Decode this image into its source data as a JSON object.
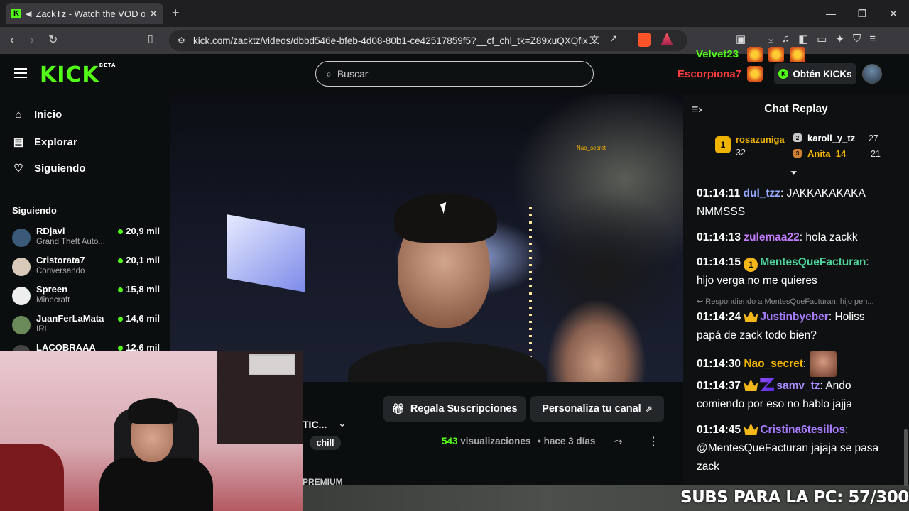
{
  "browser": {
    "tab_title": "ZackTz - Watch the VOD on K",
    "tab_close": "✕",
    "new_tab": "+",
    "url": "kick.com/zacktz/videos/dbbd546e-bfeb-4d08-80b1-ce42517859f5?__cf_chl_tk=Z89xuQXQflx...",
    "window_controls": [
      "—",
      "❐",
      "✕"
    ]
  },
  "header": {
    "logo": "KICK",
    "logo_badge": "BETA",
    "search_placeholder": "Buscar",
    "get_kicks": "Obtén KICKs"
  },
  "overlay": {
    "user1": "Velvet23",
    "user2": "Escorpiona7",
    "video_tag": "Nao_secret"
  },
  "sidebar": {
    "nav": [
      {
        "label": "Inicio",
        "icon": "home-icon"
      },
      {
        "label": "Explorar",
        "icon": "compass-icon"
      },
      {
        "label": "Siguiendo",
        "icon": "heart-icon"
      }
    ],
    "following_heading": "Siguiendo",
    "channels": [
      {
        "name": "RDjavi",
        "category": "Grand Theft Auto...",
        "viewers": "20,9 mil"
      },
      {
        "name": "Cristorata7",
        "category": "Conversando",
        "viewers": "20,1 mil"
      },
      {
        "name": "Spreen",
        "category": "Minecraft",
        "viewers": "15,8 mil"
      },
      {
        "name": "JuanFerLaMata",
        "category": "IRL",
        "viewers": "14,6 mil"
      },
      {
        "name": "LACOBRAAA",
        "category": "",
        "viewers": "12,6 mil"
      }
    ]
  },
  "video_info": {
    "title_trunc": "TIC...",
    "tag": "chill",
    "gift_button": "Regala Suscripciones",
    "customize_button": "Personaliza tu canal",
    "views_count": "543",
    "views_label": "visualizaciones",
    "date": "• hace 3 días",
    "premium": "PREMIUM",
    "subs_overlay": "SUBS PARA LA PC: 57/300"
  },
  "chat": {
    "title": "Chat Replay",
    "top_gifters": [
      {
        "rank": "1",
        "name": "rosazuniga",
        "count": "32",
        "color": "#f0b400"
      },
      {
        "rank": "2",
        "name": "karoll_y_tz",
        "count": "27",
        "color": "#c8c8c8"
      },
      {
        "rank": "3",
        "name": "Anita_14",
        "count": "21",
        "color": "#cd7f32"
      }
    ],
    "reply_context": "Respondiendo a MentesQueFacturan: hijo pen...",
    "messages": [
      {
        "time": "01:14:11",
        "user": "dul_tzz",
        "color": "#93a8ff",
        "text": "JAKKAKAKAKA NMMSSS"
      },
      {
        "time": "01:14:13",
        "user": "zulemaa22",
        "color": "#c37cff",
        "text": "hola zackk"
      },
      {
        "time": "01:14:15",
        "user": "MentesQueFacturan",
        "color": "#4ed39a",
        "text": "hijo verga no me quieres"
      },
      {
        "time": "01:14:24",
        "user": "Justinbyeber",
        "color": "#a77cff",
        "text": "Holiss papá de zack todo bien?"
      },
      {
        "time": "01:14:30",
        "user": "Nao_secret",
        "color": "#f0b400",
        "text": ""
      },
      {
        "time": "01:14:37",
        "user": "samv_tz",
        "color": "#a98cff",
        "text": "Ando comiendo por eso no hablo jajja"
      },
      {
        "time": "01:14:45",
        "user": "Cristina6tesillos",
        "color": "#a77cff",
        "text": "@MentesQueFacturan jajaja se pasa zack"
      }
    ]
  }
}
